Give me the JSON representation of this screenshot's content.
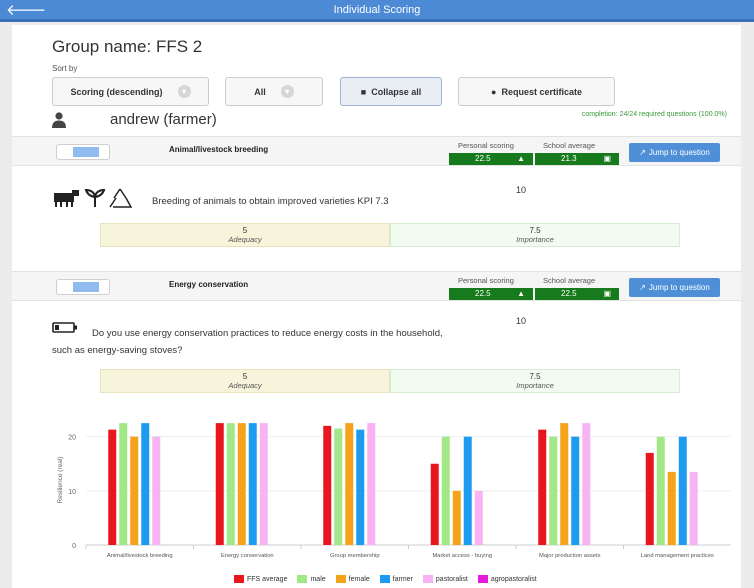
{
  "header": {
    "title": "Individual Scoring",
    "back_icon": "back-arrow-icon"
  },
  "group": {
    "name": "Group name: FFS 2"
  },
  "sort": {
    "label": "Sort by",
    "order_select": "Scoring (descending)",
    "filter_select": "All",
    "collapse_button": "Collapse all",
    "certificate_button": "Request certificate"
  },
  "completion": "completion: 24/24 required questions (100.0%)",
  "user": {
    "name": "andrew (farmer)",
    "icon": "user-icon"
  },
  "cards": [
    {
      "title": "Animal/livestock breeding",
      "personal_label": "Personal scoring",
      "personal_value": "22.5",
      "school_label": "School average",
      "school_value": "21.3",
      "jump_label": "Jump to question",
      "question": "Breeding of animals to obtain improved varieties KPI 7.3",
      "weight": "10",
      "adequacy_value": "5",
      "adequacy_label": "Adequacy",
      "importance_value": "7.5",
      "importance_label": "Importance"
    },
    {
      "title": "Energy conservation",
      "personal_label": "Personal scoring",
      "personal_value": "22.5",
      "school_label": "School average",
      "school_value": "22.5",
      "jump_label": "Jump to question",
      "question_line1": "Do you use energy conservation practices to reduce energy costs in the household,",
      "question_line2": "such as energy-saving stoves?",
      "weight": "10",
      "adequacy_value": "5",
      "adequacy_label": "Adequacy",
      "importance_value": "7.5",
      "importance_label": "Importance"
    }
  ],
  "colors": {
    "accent": "#4d8ad6",
    "score_green": "#177a1c",
    "FFS average": "#e8171f",
    "male": "#a3e887",
    "female": "#f5a31a",
    "farmer": "#1c9bf0",
    "pastoralist": "#f7b3f2",
    "agropastoralist": "#e61ad8"
  },
  "chart_data": {
    "type": "bar",
    "ylabel": "Resilience (real)",
    "ylim": [
      0,
      24
    ],
    "yticks": [
      0,
      10,
      20
    ],
    "categories": [
      "Animal/livestock breeding",
      "Energy conservation",
      "Group membership",
      "Market access - buying",
      "Major production assets",
      "Land management practices"
    ],
    "series": [
      {
        "name": "FFS average",
        "values": [
          21.3,
          22.5,
          22.0,
          15.0,
          21.3,
          17.0
        ]
      },
      {
        "name": "male",
        "values": [
          22.5,
          22.5,
          21.5,
          20.0,
          20.0,
          20.0
        ]
      },
      {
        "name": "female",
        "values": [
          20.0,
          22.5,
          22.5,
          10.0,
          22.5,
          13.5
        ]
      },
      {
        "name": "farmer",
        "values": [
          22.5,
          22.5,
          21.3,
          20.0,
          20.0,
          20.0
        ]
      },
      {
        "name": "pastoralist",
        "values": [
          20.0,
          22.5,
          22.5,
          10.0,
          22.5,
          13.5
        ]
      },
      {
        "name": "agropastoralist",
        "values": [
          0,
          0,
          0,
          0,
          0,
          0
        ]
      }
    ],
    "legend": "bottom"
  }
}
